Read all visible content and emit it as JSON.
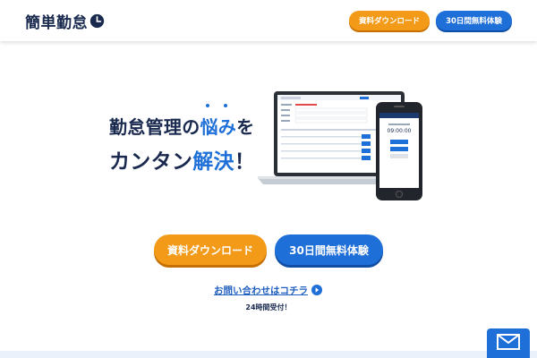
{
  "header": {
    "logo_text": "簡単勤怠",
    "download_button": "資料ダウンロード",
    "trial_button": "30日間無料体験"
  },
  "hero": {
    "line1_part1": "勤怠管理の",
    "line1_accent": "悩み",
    "line1_part2": "を",
    "line2_part1": "カンタン",
    "line2_accent": "解決",
    "line2_part2": "！"
  },
  "cta": {
    "download_button": "資料ダウンロード",
    "trial_button": "30日間無料体験",
    "contact_link": "お問い合わせはコチラ",
    "hours_note": "24時間受付！"
  },
  "mockup": {
    "phone_time": "09:00:00"
  },
  "icons": {
    "logo": "clock-icon",
    "contact": "arrow-circle-icon",
    "fab": "mail-icon"
  },
  "colors": {
    "brand_navy": "#1a2a4f",
    "accent_blue": "#1f6fd8",
    "accent_orange": "#f39a18"
  }
}
